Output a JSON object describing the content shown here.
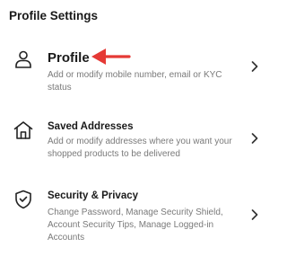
{
  "header": {
    "title": "Profile Settings"
  },
  "items": [
    {
      "title": "Profile",
      "description": "Add or modify mobile number, email or KYC status",
      "icon": "person-icon"
    },
    {
      "title": "Saved Addresses",
      "description": "Add or modify addresses where you want your shopped products to be delivered",
      "icon": "home-icon"
    },
    {
      "title": "Security & Privacy",
      "description": "Change Password, Manage Security Shield, Account Security Tips, Manage Logged-in Accounts",
      "icon": "shield-check-icon"
    }
  ],
  "colors": {
    "annotation_arrow": "#e53935",
    "description_text": "#7a7a7a",
    "title_text": "#1a1a1a"
  }
}
